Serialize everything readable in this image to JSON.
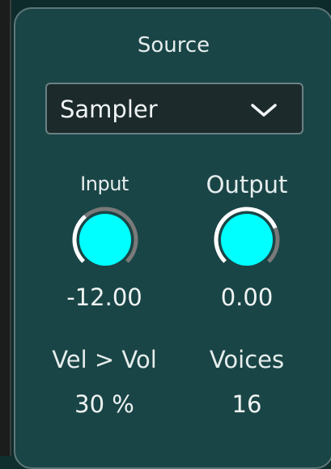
{
  "source": {
    "title": "Source",
    "dropdown": {
      "selected": "Sampler",
      "icon": "chevron-down-icon"
    },
    "input": {
      "label": "Input",
      "value": "-12.00",
      "knob_fraction": 0.35
    },
    "output": {
      "label": "Output",
      "value": "0.00",
      "knob_fraction": 0.75
    },
    "vel_vol": {
      "label": "Vel > Vol",
      "value": "30 %"
    },
    "voices": {
      "label": "Voices",
      "value": "16"
    }
  },
  "colors": {
    "panel": "#1a4546",
    "knob_fill": "#00ffff",
    "knob_ring_track": "#7a7a7a",
    "knob_ring_active": "#ffffff",
    "text": "#e6eded"
  }
}
